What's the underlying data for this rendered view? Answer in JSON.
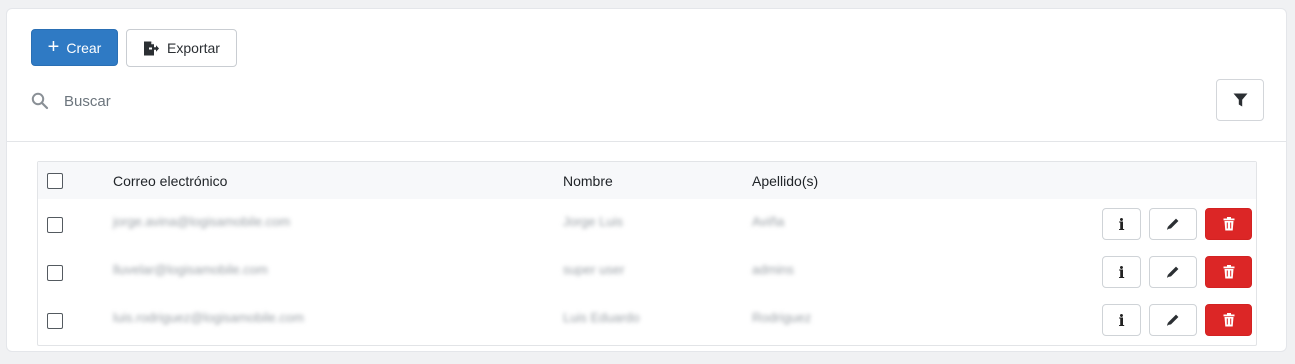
{
  "toolbar": {
    "create_label": "Crear",
    "export_label": "Exportar",
    "create_icon": "plus-icon",
    "export_icon": "file-export-icon"
  },
  "search": {
    "placeholder": "Buscar",
    "value": "",
    "icon": "search-icon"
  },
  "filter": {
    "icon": "filter-icon"
  },
  "table": {
    "columns": [
      "Correo electrónico",
      "Nombre",
      "Apellido(s)"
    ],
    "rows": [
      {
        "email": "jorge.avina@logisamobile.com",
        "nombre": "Jorge Luis",
        "apellidos": "Aviña"
      },
      {
        "email": "lluvelar@logisamobile.com",
        "nombre": "super user",
        "apellidos": "admins"
      },
      {
        "email": "luis.rodriguez@logisamobile.com",
        "nombre": "Luis Eduardo",
        "apellidos": "Rodriguez"
      }
    ],
    "row_actions": {
      "info_label": "i",
      "info_icon": "info-icon",
      "edit_icon": "pencil-icon",
      "delete_icon": "trash-icon"
    }
  },
  "colors": {
    "primary": "#2f7ac4",
    "danger": "#dc2626",
    "header_bg": "#f7f8fa"
  }
}
